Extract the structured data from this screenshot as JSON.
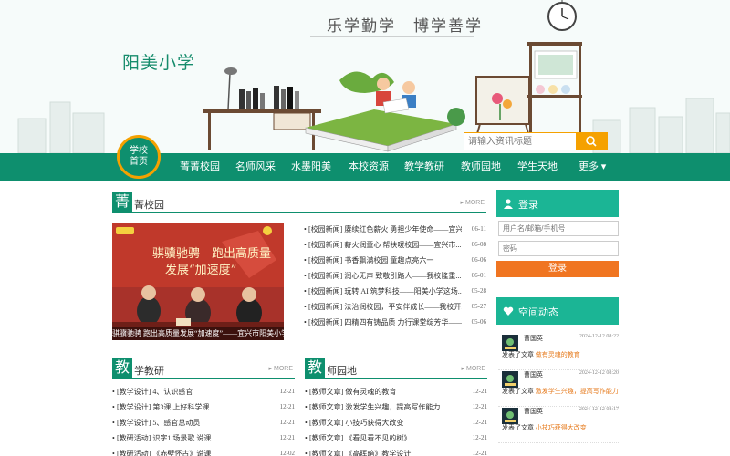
{
  "site": {
    "title": "阳美小学",
    "slogan": "乐学勤学　博学善学"
  },
  "search": {
    "placeholder": "请输入资讯标题"
  },
  "nav": {
    "home": "学校首页",
    "items": [
      "菁菁校园",
      "名师风采",
      "水墨阳美",
      "本校资源",
      "教学教研",
      "教师园地",
      "学生天地",
      "更多 ▾"
    ]
  },
  "sections": {
    "campus": {
      "badge": "菁",
      "title": "菁校园",
      "more": "MORE"
    },
    "teaching": {
      "badge": "教",
      "title": "学教研",
      "more": "MORE"
    },
    "teachers": {
      "badge": "教",
      "title": "师园地",
      "more": "MORE"
    }
  },
  "photo": {
    "caption": "骐骥驰骋 跑出高质量发展“加速度”——宜兴市阳美小学",
    "banner_line1": "骐骥驰骋　跑出高质量",
    "banner_line2": "发展“加速度”"
  },
  "campus_news": [
    {
      "title": "[校园新闻] 赓续红色薪火 勇担少年使命——宜兴...",
      "date": "06-11"
    },
    {
      "title": "[校园新闻] 薪火润童心 帮扶暖校园——宜兴市...",
      "date": "06-08"
    },
    {
      "title": "[校园新闻] 书香飘满校园 童趣点亮六一",
      "date": "06-06"
    },
    {
      "title": "[校园新闻] 润心无声 致敬引路人——我校隆重...",
      "date": "06-01"
    },
    {
      "title": "[校园新闻] 玩转 AI 筑梦科技——阳美小学这场...",
      "date": "05-28"
    },
    {
      "title": "[校园新闻] 法治润校园，平安伴成长——我校开...",
      "date": "05-27"
    },
    {
      "title": "[校园新闻] 四精四有铸品质 力行课堂绽芳华——...",
      "date": "05-06"
    }
  ],
  "teaching_news": [
    {
      "title": "[教学设计] 4、认识感官",
      "date": "12-21"
    },
    {
      "title": "[教学设计] 第3课 上好科学课",
      "date": "12-21"
    },
    {
      "title": "[教学设计] 5、感官总动员",
      "date": "12-21"
    },
    {
      "title": "[教研活动] 识字1 场景歌 说课",
      "date": "12-21"
    },
    {
      "title": "[教研活动] 《赤壁怀古》说课",
      "date": "12-02"
    }
  ],
  "teacher_news": [
    {
      "title": "[教师文章] 做有灵魂的教育",
      "date": "12-21"
    },
    {
      "title": "[教师文章] 激发学生兴趣，提高写作能力",
      "date": "12-21"
    },
    {
      "title": "[教师文章] 小技巧获得大改变",
      "date": "12-21"
    },
    {
      "title": "[教师文章] 《看见看不见的树》",
      "date": "12-21"
    },
    {
      "title": "[教师文章] 《高晖暗》教学设计",
      "date": "12-21"
    }
  ],
  "login": {
    "title": "登录",
    "username_placeholder": "用户名/邮箱/手机号",
    "password_placeholder": "密码",
    "button": "登录"
  },
  "space": {
    "title": "空间动态",
    "items": [
      {
        "name": "曹国英",
        "time": "2024-12-12 08:22",
        "action": "发表了文章",
        "link": "做有灵魂的教育"
      },
      {
        "name": "曹国英",
        "time": "2024-12-12 08:20",
        "action": "发表了文章",
        "link": "激发学生兴趣，提高写作能力"
      },
      {
        "name": "曹国英",
        "time": "2024-12-12 08:17",
        "action": "发表了文章",
        "link": "小技巧获得大改变"
      }
    ]
  },
  "colors": {
    "brand": "#0e8f6e",
    "accent": "#f5a100",
    "login_button": "#f07521",
    "side_header": "#1bb595"
  }
}
